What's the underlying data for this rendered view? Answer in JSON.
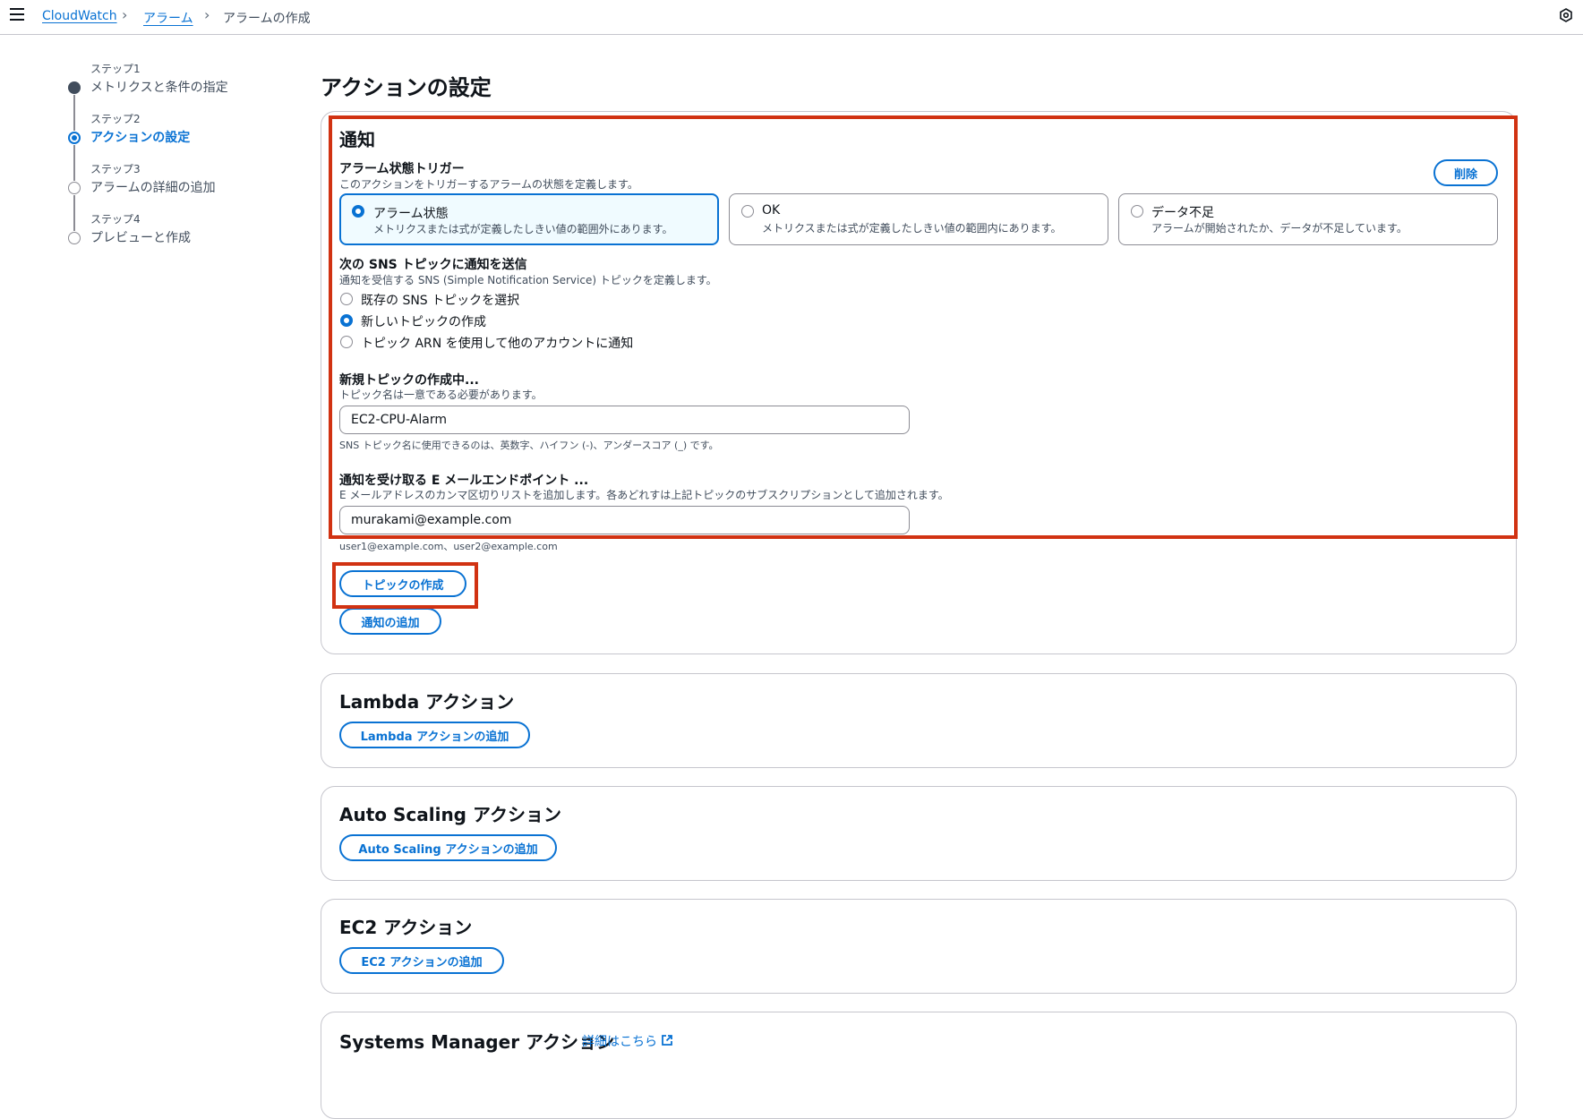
{
  "breadcrumb": {
    "root": "CloudWatch",
    "parent": "アラーム",
    "current": "アラームの作成"
  },
  "steps": [
    {
      "num": "ステップ1",
      "title": "メトリクスと条件の指定"
    },
    {
      "num": "ステップ2",
      "title": "アクションの設定"
    },
    {
      "num": "ステップ3",
      "title": "アラームの詳細の追加"
    },
    {
      "num": "ステップ4",
      "title": "プレビューと作成"
    }
  ],
  "page_title": "アクションの設定",
  "notification": {
    "title": "通知",
    "trigger_label": "アラーム状態トリガー",
    "trigger_desc": "このアクションをトリガーするアラームの状態を定義します。",
    "delete_label": "削除",
    "states": [
      {
        "label": "アラーム状態",
        "desc": "メトリクスまたは式が定義したしきい値の範囲外にあります。"
      },
      {
        "label": "OK",
        "desc": "メトリクスまたは式が定義したしきい値の範囲内にあります。"
      },
      {
        "label": "データ不足",
        "desc": "アラームが開始されたか、データが不足しています。"
      }
    ],
    "sns_label": "次の SNS トピックに通知を送信",
    "sns_desc": "通知を受信する SNS (Simple Notification Service) トピックを定義します。",
    "sns_options": [
      "既存の SNS トピックを選択",
      "新しいトピックの作成",
      "トピック ARN を使用して他のアカウントに通知"
    ],
    "new_topic_label": "新規トピックの作成中...",
    "new_topic_desc": "トピック名は一意である必要があります。",
    "topic_name": "EC2-CPU-Alarm",
    "topic_hint": "SNS トピック名に使用できるのは、英数字、ハイフン (-)、アンダースコア (_) です。",
    "email_label": "通知を受け取る E メールエンドポイント ...",
    "email_desc": "E メールアドレスのカンマ区切りリストを追加します。各あどれすは上記トピックのサブスクリプションとして追加されます。",
    "email_value": "murakami@example.com",
    "email_hint": "user1@example.com、user2@example.com",
    "create_topic_label": "トピックの作成",
    "add_notification_label": "通知の追加"
  },
  "lambda": {
    "title": "Lambda アクション",
    "button": "Lambda アクションの追加"
  },
  "autoscaling": {
    "title": "Auto Scaling アクション",
    "button": "Auto Scaling アクションの追加"
  },
  "ec2": {
    "title": "EC2 アクション",
    "button": "EC2 アクションの追加"
  },
  "ssm": {
    "title": "Systems Manager アクション",
    "link": "詳細はこちら"
  }
}
